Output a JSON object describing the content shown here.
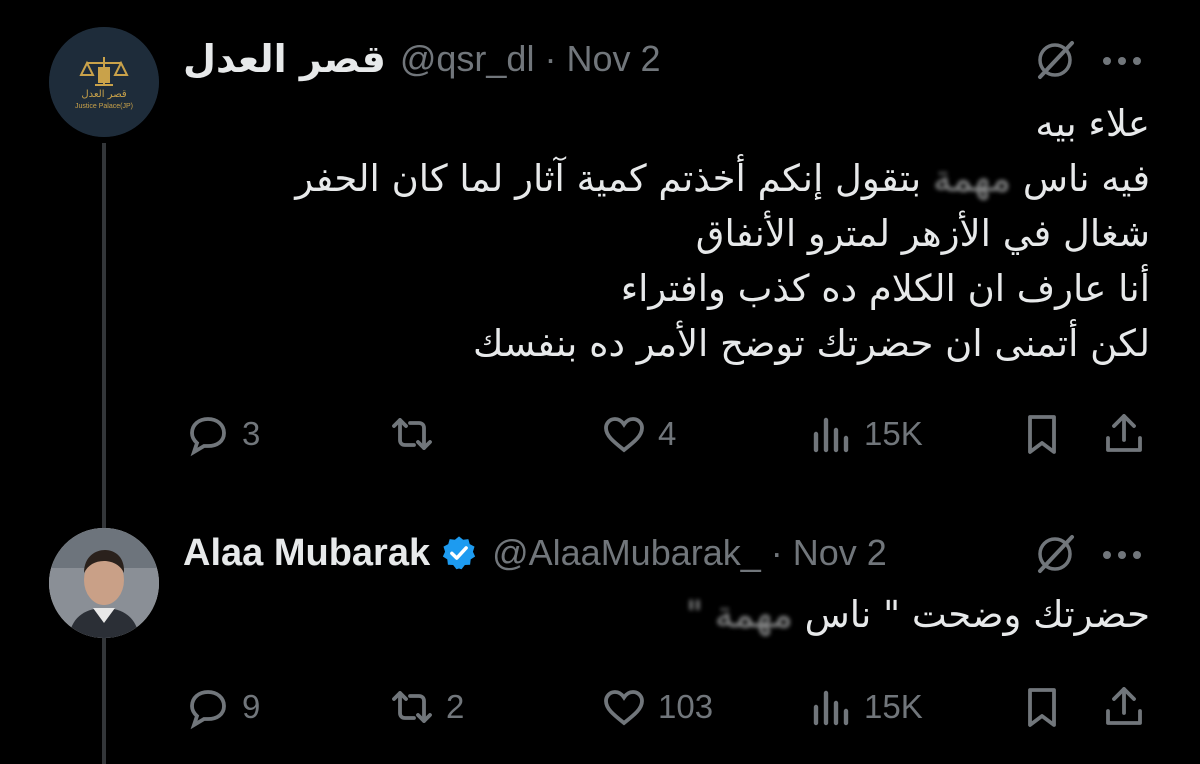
{
  "tweet1": {
    "display_name": "قصر العدل",
    "handle": "@qsr_dl",
    "separator": "·",
    "date": "Nov 2",
    "avatar_text_ar": "قصر العدل",
    "avatar_text_en": "Justice Palace(JP)",
    "lines": [
      "علاء بيه",
      "فيه ناس",
      "بتقول إنكم أخذتم كمية آثار لما كان الحفر",
      "شغال في الأزهر لمترو الأنفاق",
      "أنا عارف ان الكلام ده كذب وافتراء",
      "لكن أتمنى ان حضرتك توضح الأمر ده بنفسك"
    ],
    "blurred_word": "مهمة",
    "replies": "3",
    "reposts": "",
    "likes": "4",
    "views": "15K"
  },
  "tweet2": {
    "display_name": "Alaa Mubarak",
    "handle": "@AlaaMubarak_",
    "separator": "·",
    "date": "Nov 2",
    "verified": true,
    "text_prefix": "حضرتك وضحت \" ناس",
    "blurred_word": "مهمة \"",
    "replies": "9",
    "reposts": "2",
    "likes": "103",
    "views": "15K"
  },
  "colors": {
    "background": "#000000",
    "text": "#e7e9ea",
    "muted": "#71767b",
    "verified": "#1d9bf0",
    "line": "#333639"
  },
  "icons": [
    "grok-icon",
    "more-icon",
    "reply-icon",
    "repost-icon",
    "like-icon",
    "views-icon",
    "bookmark-icon",
    "share-icon",
    "verified-badge-icon"
  ]
}
